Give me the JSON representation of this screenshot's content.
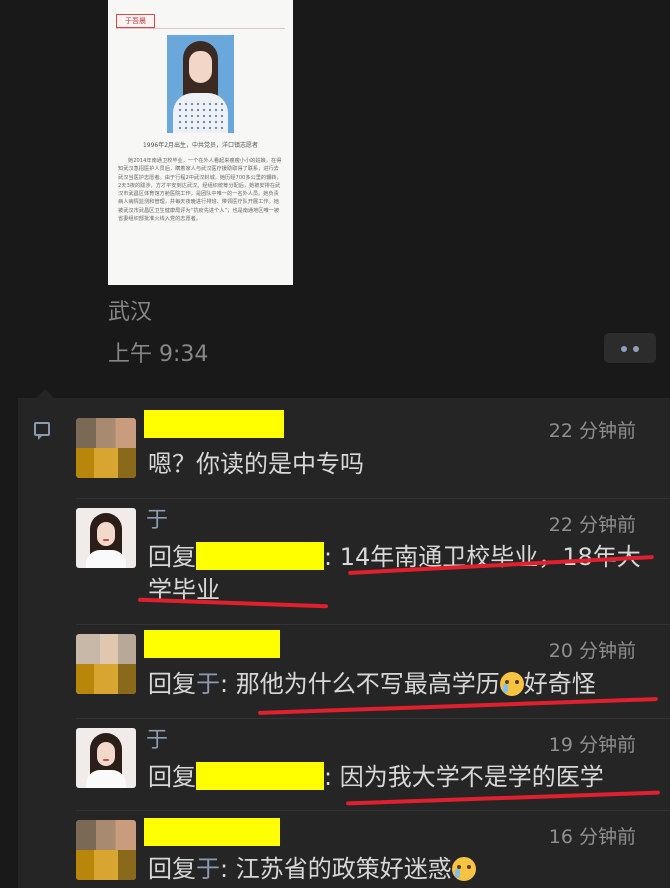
{
  "post": {
    "image": {
      "name_tag": "于吾晨",
      "caption": "1996年2月出生，中共党员，洋口镇志愿者",
      "body": "她2014年南通卫校毕业，一个在外人看起来瘦瘦小小的姑娘，在得知武汉急招医护人员后，瞒着家人与武汉医疗援助取得了联系，进行去武汉当医护志愿者。由于行程2中武汉封城，她历经700多公里的辗转，2天3夜的跋涉，方才平安到达武汉。经组织统筹分配后，她被安排在武汉市武昌区体育馆方舱医院工作，是团队中唯一的一名外人员。她负责病人病情监测和管理，并每天夜晚进行排班、带领医疗队开展工作。她被武汉市武昌区卫生健康局评为“抗疫先进个人”，也是南通地区唯一被省委组织部批准火线入党的志愿者。"
    },
    "location": "武汉",
    "time": "上午 9:34"
  },
  "comments": [
    {
      "time": "22 分钟前",
      "text": "嗯？你读的是中专吗"
    },
    {
      "nickname": "于",
      "time": "22 分钟前",
      "reply_prefix": "回复",
      "text": ": 14年南通卫校毕业，18年大学毕业"
    },
    {
      "time": "20 分钟前",
      "reply_prefix": "回复",
      "reply_to": "于",
      "text": ": 那他为什么不写最高学历",
      "text_tail": "好奇怪"
    },
    {
      "nickname": "于",
      "time": "19 分钟前",
      "reply_prefix": "回复",
      "text": ": 因为我大学不是学的医学"
    },
    {
      "time": "16 分钟前",
      "reply_prefix": "回复",
      "reply_to": "于",
      "text": ": 江苏省的政策好迷惑"
    }
  ],
  "icons": {
    "more": "more-dots-icon",
    "comment": "comment-icon",
    "emoji": "crying-laughing-emoji-icon"
  },
  "colors": {
    "background": "#191919",
    "panel": "#252525",
    "link": "#8a9bb3",
    "redaction": "#ffff00",
    "annotation": "#e11f2d"
  }
}
